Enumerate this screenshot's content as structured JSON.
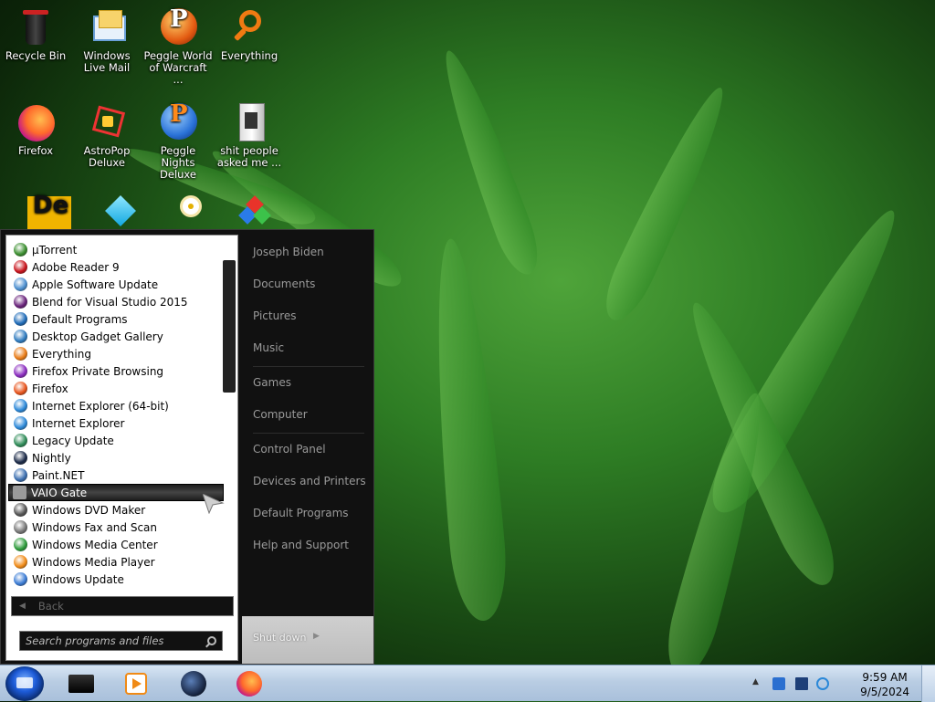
{
  "desktop": {
    "icons": [
      {
        "label": "Recycle Bin",
        "icon": "recycle-bin-icon"
      },
      {
        "label": "Windows Live Mail",
        "icon": "mail-icon"
      },
      {
        "label": "Peggle World of Warcraft ...",
        "icon": "peggle-icon"
      },
      {
        "label": "Everything",
        "icon": "magnifier-icon"
      },
      {
        "label": "Firefox",
        "icon": "firefox-icon"
      },
      {
        "label": "AstroPop Deluxe",
        "icon": "astropop-icon"
      },
      {
        "label": "Peggle Nights Deluxe",
        "icon": "peggle-icon"
      },
      {
        "label": "shit people asked me ...",
        "icon": "document-icon"
      },
      {
        "label": "",
        "icon": "de-icon"
      },
      {
        "label": "",
        "icon": "diamond-icon"
      },
      {
        "label": "",
        "icon": "flower-icon"
      },
      {
        "label": "",
        "icon": "shapes-icon"
      }
    ]
  },
  "start_menu": {
    "programs": [
      {
        "label": "µTorrent",
        "icon": "utorrent-icon",
        "color": "#3a8e2e"
      },
      {
        "label": "Adobe Reader 9",
        "icon": "adobe-reader-icon",
        "color": "#c9141c"
      },
      {
        "label": "Apple Software Update",
        "icon": "apple-update-icon",
        "color": "#4c8fd0"
      },
      {
        "label": "Blend for Visual Studio 2015",
        "icon": "blend-icon",
        "color": "#68217a"
      },
      {
        "label": "Default Programs",
        "icon": "default-programs-icon",
        "color": "#1e6bb8"
      },
      {
        "label": "Desktop Gadget Gallery",
        "icon": "gadget-icon",
        "color": "#2f7bbf"
      },
      {
        "label": "Everything",
        "icon": "magnifier-icon",
        "color": "#e97b16"
      },
      {
        "label": "Firefox Private Browsing",
        "icon": "firefox-private-icon",
        "color": "#8a2bbf"
      },
      {
        "label": "Firefox",
        "icon": "firefox-icon",
        "color": "#e8541c"
      },
      {
        "label": "Internet Explorer (64-bit)",
        "icon": "ie-icon",
        "color": "#2b88d8"
      },
      {
        "label": "Internet Explorer",
        "icon": "ie-icon",
        "color": "#2b88d8"
      },
      {
        "label": "Legacy Update",
        "icon": "legacy-update-icon",
        "color": "#2e8b57"
      },
      {
        "label": "Nightly",
        "icon": "nightly-icon",
        "color": "#1b2a48"
      },
      {
        "label": "Paint.NET",
        "icon": "paintnet-icon",
        "color": "#3c6fb0"
      },
      {
        "label": "VAIO Gate",
        "icon": "vaio-gate-icon",
        "color": "#888888",
        "selected": true
      },
      {
        "label": "Windows DVD Maker",
        "icon": "dvd-maker-icon",
        "color": "#555555"
      },
      {
        "label": "Windows Fax and Scan",
        "icon": "fax-icon",
        "color": "#777777"
      },
      {
        "label": "Windows Media Center",
        "icon": "media-center-icon",
        "color": "#2d9b3b"
      },
      {
        "label": "Windows Media Player",
        "icon": "media-player-icon",
        "color": "#f08a16"
      },
      {
        "label": "Windows Update",
        "icon": "windows-update-icon",
        "color": "#3a7bd5"
      }
    ],
    "back_label": "Back",
    "search_placeholder": "Search programs and files",
    "right_links": [
      {
        "label": "Joseph Biden"
      },
      {
        "label": "Documents"
      },
      {
        "label": "Pictures"
      },
      {
        "label": "Music"
      },
      {
        "label": "Games"
      },
      {
        "label": "Computer"
      },
      {
        "label": "Control Panel"
      },
      {
        "label": "Devices and Printers"
      },
      {
        "label": "Default Programs"
      },
      {
        "label": "Help and Support"
      }
    ],
    "shutdown_label": "Shut down"
  },
  "taskbar": {
    "pinned": [
      {
        "icon": "computer-icon"
      },
      {
        "icon": "media-player-icon"
      },
      {
        "icon": "nightly-icon"
      },
      {
        "icon": "firefox-icon"
      }
    ],
    "clock_time": "9:59 AM",
    "clock_date": "9/5/2024"
  }
}
